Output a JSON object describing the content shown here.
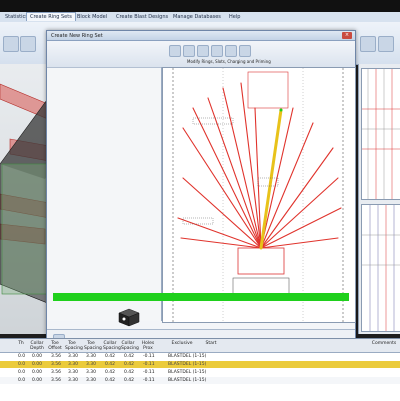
{
  "menu": {
    "items": [
      "Statistics",
      "Create Ring Sets",
      "Block Model",
      "Create Blast Designs",
      "Manage Databases",
      "Help"
    ],
    "active_index": 1
  },
  "dialog": {
    "title": "Create New Ring Set",
    "ribbon_label": "Modify Rings, Slots, Charging and Priming"
  },
  "table": {
    "headers": [
      "Th",
      "Collar Depth",
      "Toe Offset",
      "Toe Spacing",
      "Toe Spacing",
      "Collar Spacing",
      "Collar Spacing",
      "Holes Prox",
      "Exclusive",
      "Start",
      "Comments"
    ],
    "rows": [
      [
        "0.0",
        "0.00",
        "3.56",
        "3.30",
        "3.30",
        "0.42",
        "0.42",
        "-0.11",
        "BLASTDEL (1-15)"
      ],
      [
        "0.0",
        "0.00",
        "3.56",
        "3.30",
        "3.30",
        "0.42",
        "0.42",
        "-0.11",
        "BLASTDEL (1-15)"
      ],
      [
        "0.0",
        "0.00",
        "3.56",
        "3.30",
        "3.30",
        "0.42",
        "0.42",
        "-0.11",
        "BLASTDEL (1-15)"
      ],
      [
        "0.0",
        "0.00",
        "3.56",
        "3.30",
        "3.30",
        "0.42",
        "0.42",
        "-0.11",
        "BLASTDEL (1-15)"
      ]
    ],
    "highlight_row": 1
  },
  "colors": {
    "accent_green": "#1fd01c",
    "holes_red": "#e0332c",
    "selected_hole": "#e8c21a"
  }
}
